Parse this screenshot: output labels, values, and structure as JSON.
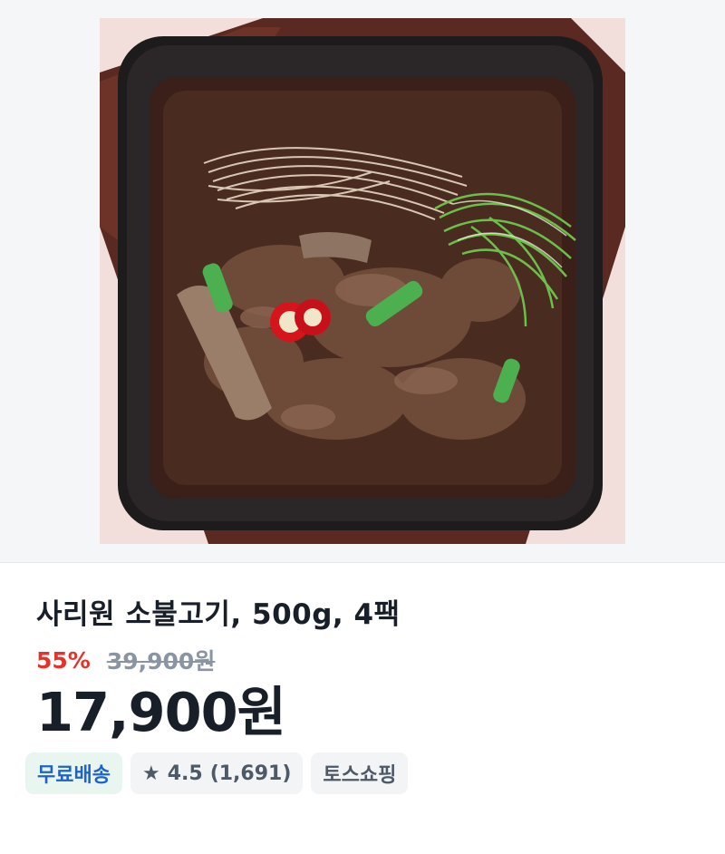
{
  "product": {
    "image_alt": "Bulgogi in a square black pan",
    "title": "사리원 소불고기, 500g, 4팩",
    "discount_percent": "55%",
    "original_price": "39,900원",
    "sale_price": "17,900원"
  },
  "badges": {
    "shipping": "무료배송",
    "rating_icon": "star-icon",
    "rating": "4.5",
    "review_count": "(1,691)",
    "store": "토스쇼핑"
  },
  "colors": {
    "discount": "#e5332a",
    "shipping_text": "#1e64c8",
    "shipping_bg": "#e8f6ef"
  }
}
